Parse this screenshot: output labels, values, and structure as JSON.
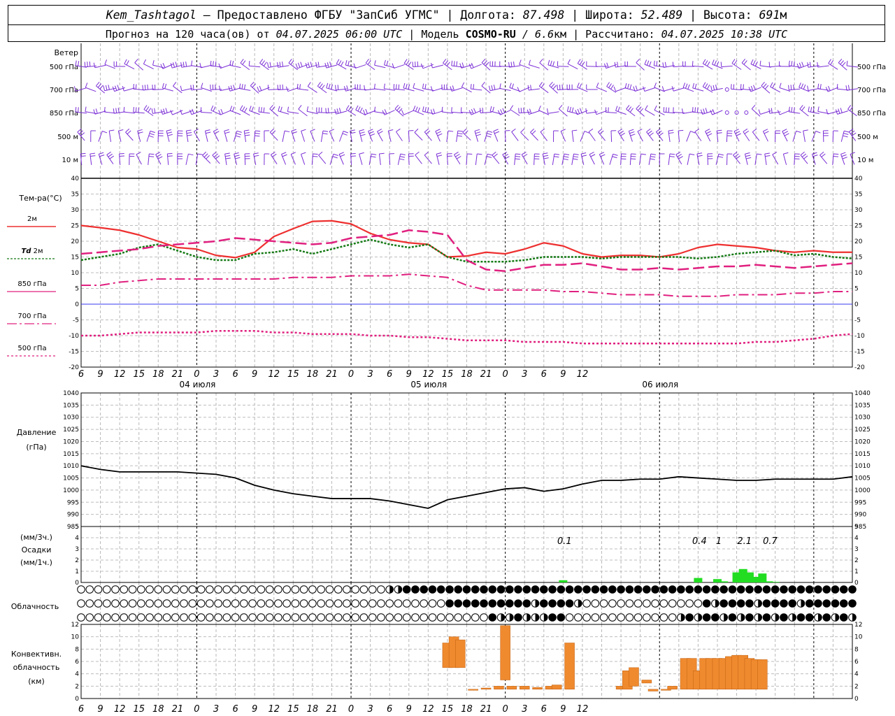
{
  "header": {
    "station": "Kem_Tashtagol",
    "sep1": " — Предоставлено ФГБУ \"ЗапСиб УГМС\" | Долгота: ",
    "lon": "87.498",
    "sep2": " | Широта: ",
    "lat": "52.489",
    "sep3": " | Высота: ",
    "alt": "691",
    "alt_unit": "м",
    "line2_a": "Прогноз на 120 часа(ов) от ",
    "fc_from": "04.07.2025 06:00 UTC",
    "line2_b": "  | Модель ",
    "model": "COSMO-RU",
    "model_res": " / 6.6",
    "res_unit": "км",
    "line2_c": " | Рассчитано: ",
    "calc_time": "04.07.2025 10:38 UTC"
  },
  "time_axis": {
    "ticks": [
      "6",
      "9",
      "12",
      "15",
      "18",
      "21",
      "0",
      "3",
      "6",
      "9",
      "12",
      "15",
      "18",
      "21",
      "0",
      "3",
      "6",
      "9",
      "12",
      "15",
      "18",
      "21",
      "0",
      "3",
      "6",
      "9",
      "12"
    ],
    "dates": [
      "04 июля",
      "05 июля",
      "06 июля"
    ]
  },
  "wind_panel": {
    "title": "Ветер",
    "levels": [
      "500 гПа",
      "700 гПа",
      "850 гПа",
      "500 м",
      "10 м"
    ],
    "color": "#7b2fd6"
  },
  "temp_panel": {
    "title": "Тем-ра(°C)",
    "legend": [
      {
        "label": "2м",
        "bold": "",
        "color": "#ee3030"
      },
      {
        "label": " 2м",
        "bold": "Td",
        "color": "#157a15"
      },
      {
        "label": "850 гПа",
        "bold": "",
        "color": "#e0207f"
      },
      {
        "label": "700 гПа",
        "bold": "",
        "color": "#e0207f"
      },
      {
        "label": "500 гПа",
        "bold": "",
        "color": "#e0207f"
      }
    ],
    "yticks": [
      "40",
      "35",
      "30",
      "25",
      "20",
      "15",
      "10",
      "5",
      "0",
      "-5",
      "-10",
      "-15",
      "-20"
    ]
  },
  "pressure_panel": {
    "title1": "Давление",
    "title2": "(гПа)",
    "yticks": [
      "1040",
      "1035",
      "1030",
      "1025",
      "1020",
      "1015",
      "1010",
      "1005",
      "1000",
      "995",
      "990",
      "985"
    ]
  },
  "precip_panel": {
    "title1": "(мм/3ч.)",
    "title2": "Осадки",
    "title3": "(мм/1ч.)",
    "yticks": [
      "5",
      "4",
      "3",
      "2",
      "1",
      "0"
    ],
    "totals": [
      "0.1",
      "0.4",
      "1",
      "2.1",
      "0.7"
    ]
  },
  "cloud_panel": {
    "title": "Облачность"
  },
  "conv_panel": {
    "title1": "Конвективн.",
    "title2": "облачность",
    "title3": "(км)",
    "yticks": [
      "12",
      "10",
      "8",
      "6",
      "4",
      "2",
      "0"
    ]
  },
  "chart_data": [
    {
      "type": "line",
      "title": "Тем-ра(°C)",
      "x_unit": "hours from 04.07 06 UTC",
      "x": [
        0,
        3,
        6,
        9,
        12,
        15,
        18,
        21,
        24,
        27,
        30,
        33,
        36,
        39,
        42,
        45,
        48,
        51,
        54,
        57,
        60,
        63,
        66,
        69,
        72,
        75,
        78,
        81,
        84,
        87,
        90,
        93,
        96,
        99,
        102,
        105,
        108,
        111,
        114,
        117,
        120
      ],
      "ylim": [
        -20,
        40
      ],
      "series": [
        {
          "name": "2м",
          "color": "#ee3030",
          "values": [
            25,
            24.3,
            23.5,
            22,
            20,
            18,
            17.5,
            15.5,
            14.8,
            16.5,
            21.5,
            24,
            26.3,
            26.5,
            25.5,
            22.5,
            20.5,
            19.5,
            19,
            15,
            15.3,
            16.5,
            16,
            17.5,
            19.5,
            18.5,
            16,
            15,
            15.5,
            15.5,
            15,
            16,
            18,
            19,
            18.5,
            18,
            17,
            16.5,
            17,
            16.5,
            16.5
          ]
        },
        {
          "name": "Td 2м",
          "color": "#157a15",
          "values": [
            14,
            15,
            16,
            18,
            19,
            17,
            15,
            14,
            14,
            16,
            16.5,
            17.5,
            16,
            17.5,
            19,
            20.5,
            19,
            18,
            19,
            15,
            13.5,
            13.5,
            13.5,
            14,
            15,
            15,
            15,
            14.5,
            15,
            15,
            15,
            15,
            14.5,
            15,
            16,
            16.5,
            17,
            15.5,
            16,
            15,
            14.5
          ]
        },
        {
          "name": "850 гПа",
          "color": "#e0207f",
          "values": [
            16,
            16.5,
            17,
            17.5,
            18.5,
            19,
            19.5,
            20,
            21,
            20.5,
            20,
            19.5,
            19,
            19.5,
            21,
            21.5,
            22,
            23.5,
            23,
            22,
            14,
            11,
            10.5,
            11.5,
            12.5,
            12.5,
            13,
            12,
            11,
            11,
            11.5,
            11,
            11.5,
            12,
            12,
            12.5,
            12,
            11.5,
            12,
            12.5,
            13
          ]
        },
        {
          "name": "700 гПа",
          "color": "#e0207f",
          "values": [
            6,
            6,
            7,
            7.5,
            8,
            8,
            8,
            8,
            8,
            8,
            8,
            8.5,
            8.5,
            8.5,
            9,
            9,
            9,
            9.5,
            9,
            8.5,
            6,
            4.5,
            4.5,
            4.5,
            4.5,
            4,
            4,
            3.5,
            3,
            3,
            3,
            2.5,
            2.5,
            2.5,
            3,
            3,
            3,
            3.5,
            3.5,
            4,
            4
          ]
        },
        {
          "name": "500 гПа",
          "color": "#e0207f",
          "values": [
            -10,
            -10,
            -9.5,
            -9,
            -9,
            -9,
            -9,
            -8.5,
            -8.5,
            -8.5,
            -9,
            -9,
            -9.5,
            -9.5,
            -9.5,
            -10,
            -10,
            -10.5,
            -10.5,
            -11,
            -11.5,
            -11.5,
            -11.5,
            -12,
            -12,
            -12,
            -12.5,
            -12.5,
            -12.5,
            -12.5,
            -12.5,
            -12.5,
            -12.5,
            -12.5,
            -12.5,
            -12,
            -12,
            -11.5,
            -11,
            -10,
            -9.5
          ]
        }
      ]
    },
    {
      "type": "line",
      "title": "Давление (гПа)",
      "x_unit": "hours from 04.07 06 UTC",
      "x": [
        0,
        3,
        6,
        9,
        12,
        15,
        18,
        21,
        24,
        27,
        30,
        33,
        36,
        39,
        42,
        45,
        48,
        51,
        54,
        57,
        60,
        63,
        66,
        69,
        72,
        75,
        78,
        81,
        84,
        87,
        90,
        93,
        96,
        99,
        102,
        105,
        108,
        111,
        114,
        117,
        120
      ],
      "ylim": [
        985,
        1040
      ],
      "series": [
        {
          "name": "Давление",
          "color": "#000000",
          "values": [
            1010,
            1008.5,
            1007.5,
            1007.5,
            1007.5,
            1007.5,
            1007,
            1006.5,
            1005,
            1002,
            1000,
            998.5,
            997.5,
            996.5,
            996.5,
            996.5,
            995.5,
            994,
            992.5,
            996,
            997.5,
            999,
            1000.5,
            1001,
            999.5,
            1000.5,
            1002.5,
            1004,
            1004,
            1004.5,
            1004.5,
            1005.5,
            1005,
            1004.5,
            1004,
            1004,
            1004.5,
            1004.5,
            1004.5,
            1004.5,
            1005.5
          ]
        }
      ]
    },
    {
      "type": "bar",
      "title": "Осадки (мм/1ч.)",
      "x_unit": "hours from 04.07 06 UTC",
      "x": [
        75,
        96,
        99,
        100,
        102,
        103,
        104,
        105,
        106,
        107,
        108
      ],
      "ylim": [
        0,
        5
      ],
      "series": [
        {
          "name": "Осадки",
          "color": "#22dd22",
          "values": [
            0.2,
            0.4,
            0.3,
            0.1,
            0.9,
            1.2,
            0.9,
            0.5,
            0.8,
            0.1,
            0.05
          ]
        }
      ]
    },
    {
      "type": "bar",
      "title": "Конвективн. облачность (км)",
      "x_unit": "hours from 04.07 06 UTC",
      "ylim": [
        0,
        12
      ],
      "color": "#ef8a2f",
      "bars": [
        {
          "x": 57,
          "bottom": 5,
          "top": 9
        },
        {
          "x": 58,
          "bottom": 5,
          "top": 10
        },
        {
          "x": 59,
          "bottom": 5,
          "top": 9.5
        },
        {
          "x": 61,
          "bottom": 1.5,
          "top": 1.5
        },
        {
          "x": 63,
          "bottom": 1.5,
          "top": 1.7
        },
        {
          "x": 65,
          "bottom": 1.5,
          "top": 2
        },
        {
          "x": 66,
          "bottom": 3,
          "top": 11.8
        },
        {
          "x": 67,
          "bottom": 1.5,
          "top": 2
        },
        {
          "x": 69,
          "bottom": 1.5,
          "top": 2
        },
        {
          "x": 71,
          "bottom": 1.5,
          "top": 1.8
        },
        {
          "x": 73,
          "bottom": 1.5,
          "top": 2
        },
        {
          "x": 74,
          "bottom": 1.5,
          "top": 2.2
        },
        {
          "x": 76,
          "bottom": 1.5,
          "top": 9
        },
        {
          "x": 84,
          "bottom": 1.5,
          "top": 2
        },
        {
          "x": 85,
          "bottom": 1.5,
          "top": 4.5
        },
        {
          "x": 86,
          "bottom": 2,
          "top": 5
        },
        {
          "x": 88,
          "bottom": 2.5,
          "top": 3
        },
        {
          "x": 89,
          "bottom": 1.2,
          "top": 1.5
        },
        {
          "x": 91,
          "bottom": 1.5,
          "top": 1.5
        },
        {
          "x": 92,
          "bottom": 1.5,
          "top": 2
        },
        {
          "x": 94,
          "bottom": 1.5,
          "top": 6.5
        },
        {
          "x": 95,
          "bottom": 1.5,
          "top": 6.5
        },
        {
          "x": 96,
          "bottom": 1.5,
          "top": 4.5
        },
        {
          "x": 97,
          "bottom": 1.5,
          "top": 6.5
        },
        {
          "x": 98,
          "bottom": 1.5,
          "top": 6.5
        },
        {
          "x": 99,
          "bottom": 1.5,
          "top": 6.5
        },
        {
          "x": 100,
          "bottom": 1.5,
          "top": 6.5
        },
        {
          "x": 101,
          "bottom": 1.5,
          "top": 6.8
        },
        {
          "x": 102,
          "bottom": 1.5,
          "top": 7
        },
        {
          "x": 103,
          "bottom": 1.5,
          "top": 7
        },
        {
          "x": 104,
          "bottom": 1.5,
          "top": 6.5
        },
        {
          "x": 105,
          "bottom": 1.5,
          "top": 6.3
        },
        {
          "x": 106,
          "bottom": 1.5,
          "top": 6.3
        }
      ]
    }
  ]
}
